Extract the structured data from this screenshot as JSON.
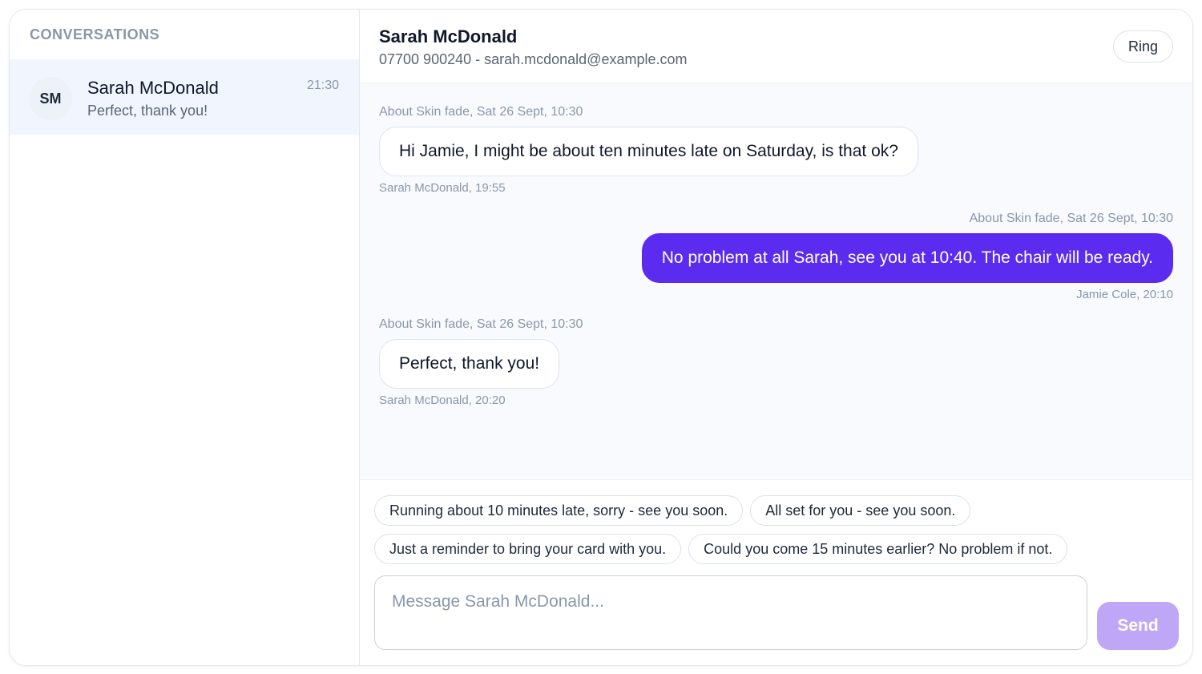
{
  "sidebar": {
    "title": "CONVERSATIONS",
    "conversations": [
      {
        "initials": "SM",
        "name": "Sarah McDonald",
        "preview": "Perfect, thank you!",
        "time": "21:30"
      }
    ]
  },
  "header": {
    "contact_name": "Sarah McDonald",
    "contact_details": "07700 900240 - sarah.mcdonald@example.com",
    "ring_label": "Ring"
  },
  "messages": [
    {
      "direction": "incoming",
      "context": "About Skin fade, Sat 26 Sept, 10:30",
      "text": "Hi Jamie, I might be about ten minutes late on Saturday, is that ok?",
      "meta": "Sarah McDonald, 19:55"
    },
    {
      "direction": "outgoing",
      "context": "About Skin fade, Sat 26 Sept, 10:30",
      "text": "No problem at all Sarah, see you at 10:40. The chair will be ready.",
      "meta": "Jamie Cole, 20:10"
    },
    {
      "direction": "incoming",
      "context": "About Skin fade, Sat 26 Sept, 10:30",
      "text": "Perfect, thank you!",
      "meta": "Sarah McDonald, 20:20"
    }
  ],
  "quick_replies": [
    "Running about 10 minutes late, sorry - see you soon.",
    "All set for you - see you soon.",
    "Just a reminder to bring your card with you.",
    "Could you come 15 minutes earlier? No problem if not."
  ],
  "composer": {
    "placeholder": "Message Sarah McDonald...",
    "value": "",
    "send_label": "Send"
  },
  "colors": {
    "accent": "#5b2cf0",
    "send_disabled": "#c0a6f7",
    "selected_row": "#f1f5fd",
    "muted_text": "#8a97ab"
  }
}
